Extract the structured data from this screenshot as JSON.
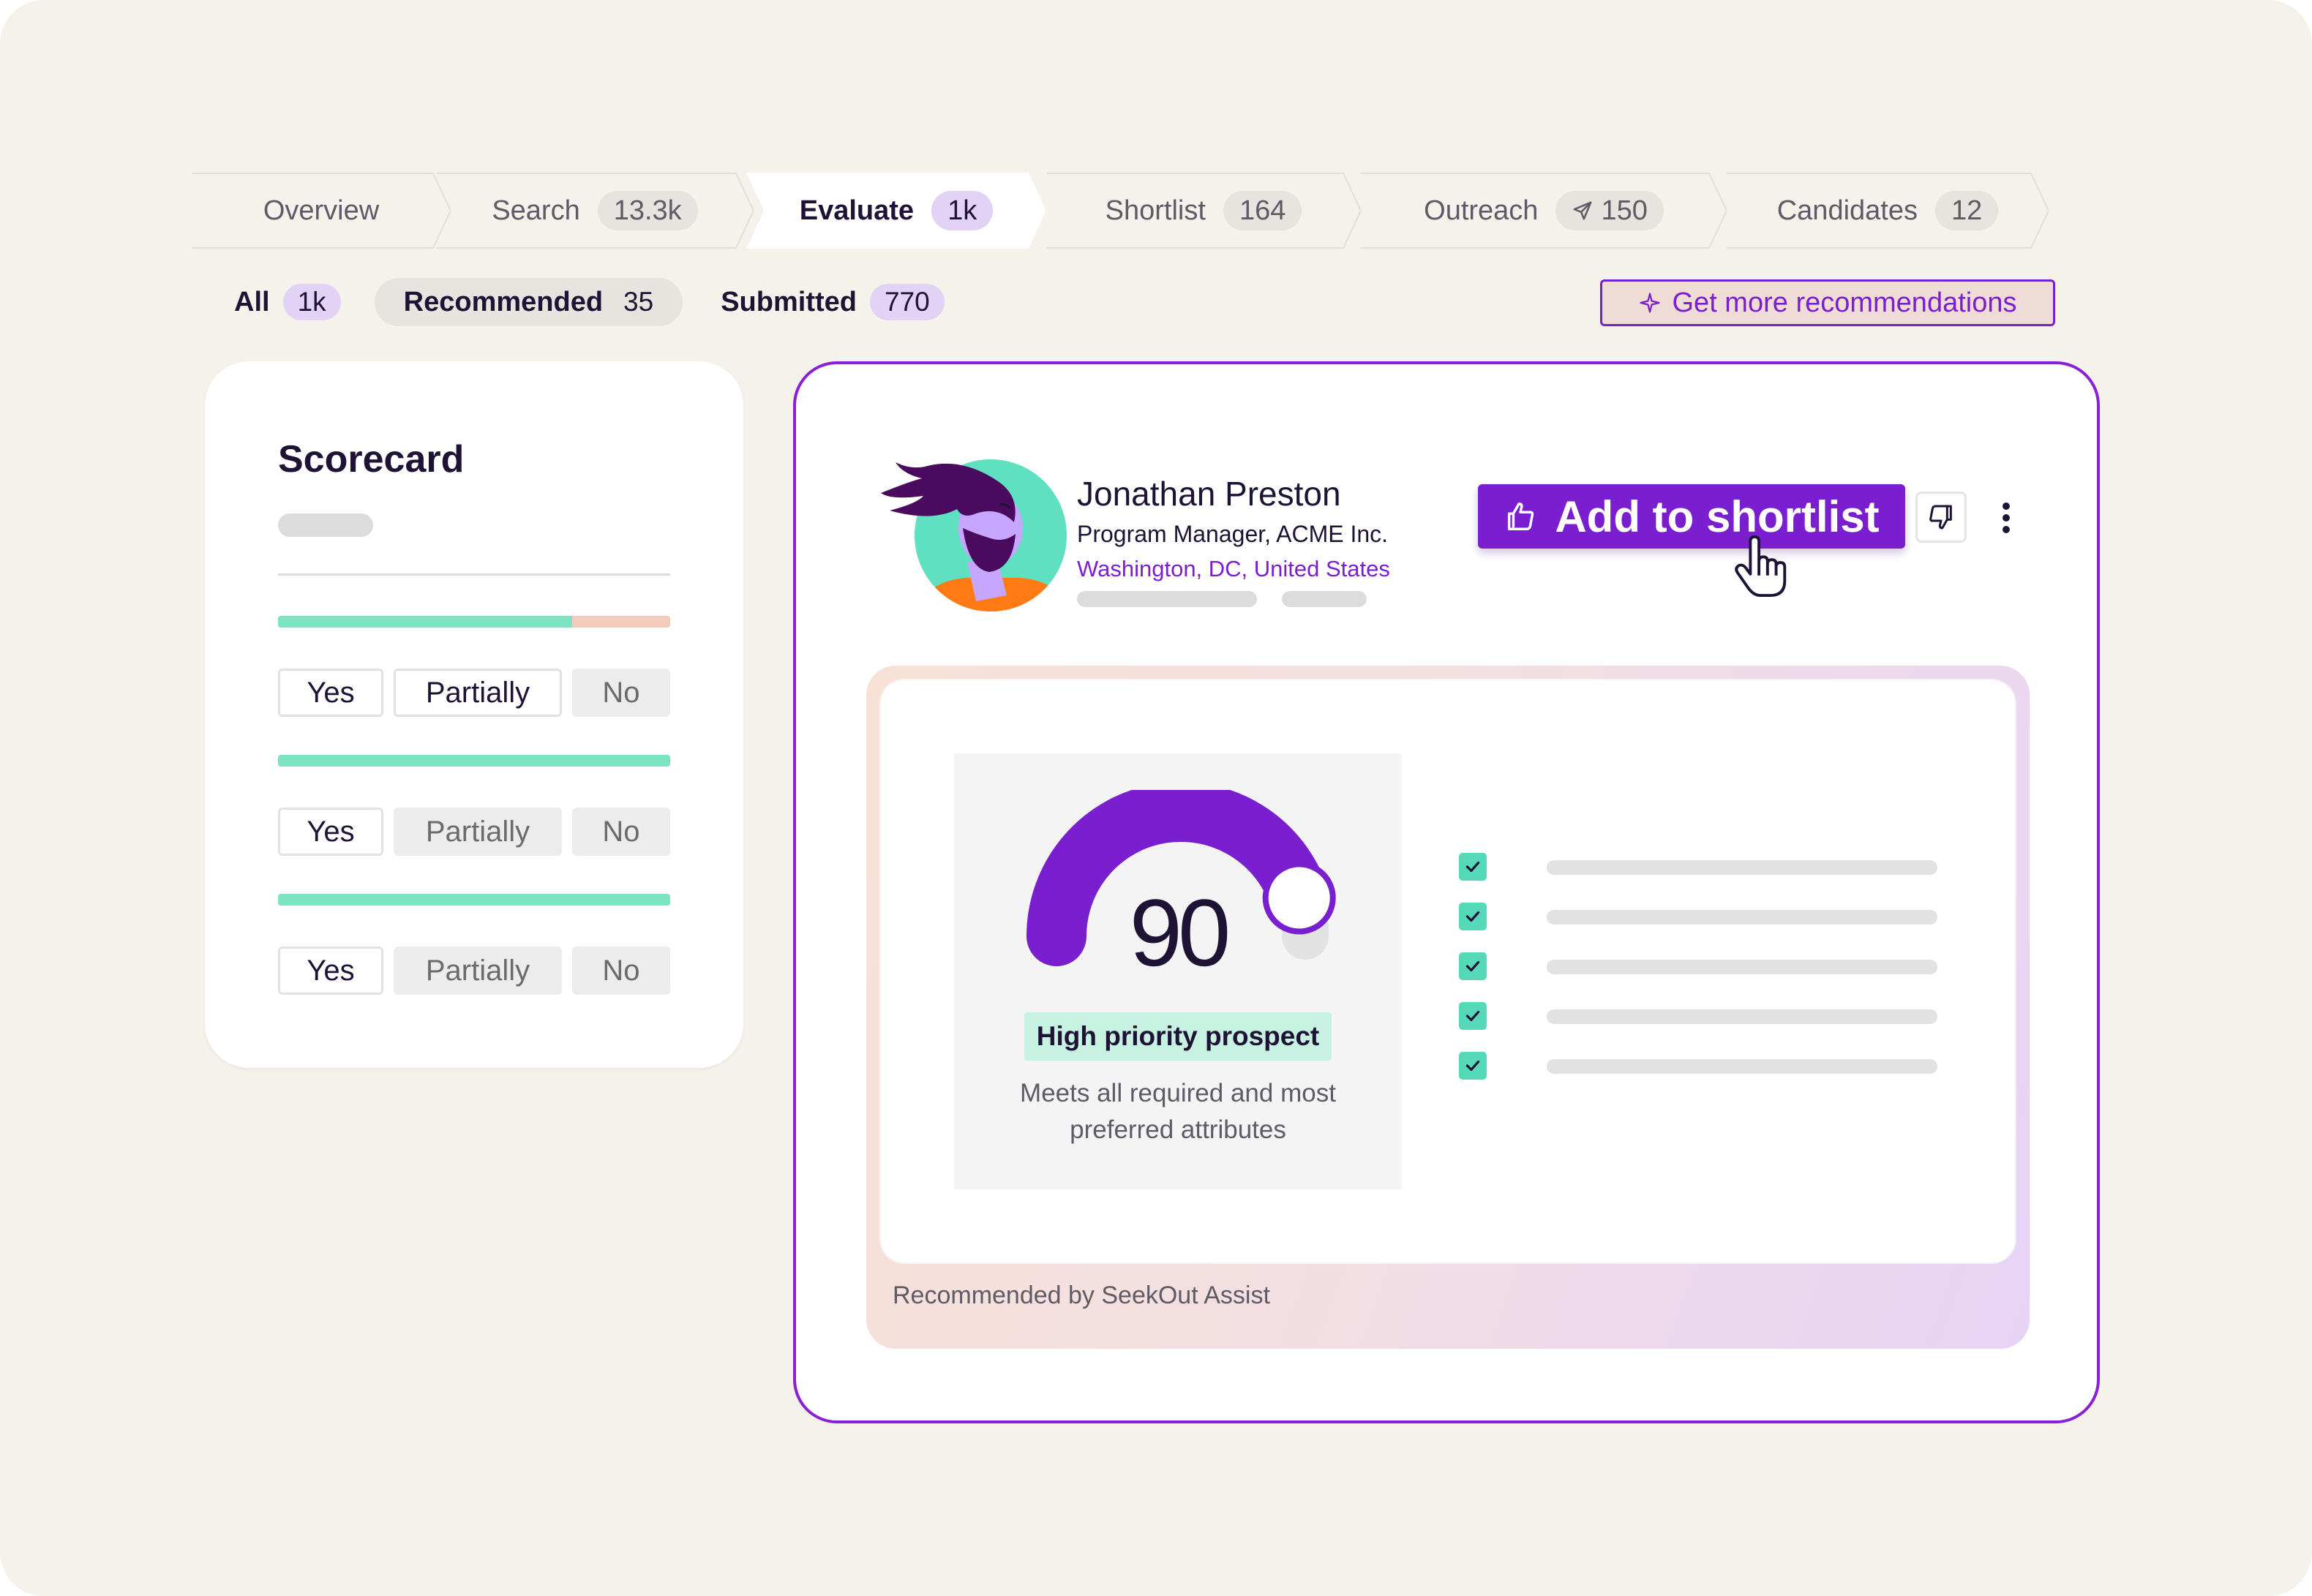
{
  "stages": [
    {
      "label": "Overview",
      "count": ""
    },
    {
      "label": "Search",
      "count": "13.3k"
    },
    {
      "label": "Evaluate",
      "count": "1k"
    },
    {
      "label": "Shortlist",
      "count": "164"
    },
    {
      "label": "Outreach",
      "count": "150",
      "count_icon": "send-icon"
    },
    {
      "label": "Candidates",
      "count": "12"
    }
  ],
  "active_stage": "Evaluate",
  "filters": [
    {
      "label": "All",
      "count": "1k"
    },
    {
      "label": "Recommended",
      "count": "35"
    },
    {
      "label": "Submitted",
      "count": "770"
    }
  ],
  "selected_filter": "Recommended",
  "get_more_label": "Get more recommendations",
  "scorecard": {
    "title": "Scorecard",
    "options": {
      "yes": "Yes",
      "partially": "Partially",
      "no": "No"
    },
    "criteria": [
      {
        "fill": 0.75,
        "selected": "Partially"
      },
      {
        "fill": 1.0,
        "selected": "Yes"
      },
      {
        "fill": 1.0,
        "selected": "Yes"
      }
    ]
  },
  "candidate": {
    "name": "Jonathan Preston",
    "title": "Program Manager, ACME Inc.",
    "location": "Washington, DC, United States"
  },
  "actions": {
    "shortlist_label": "Add to shortlist",
    "dislike_icon": "thumbs-down-icon",
    "more_icon": "more-vertical-icon"
  },
  "assist": {
    "score": "90",
    "score_fraction": 0.9,
    "priority": "High priority prospect",
    "description": "Meets all required and most preferred attributes",
    "footer": "Recommended by SeekOut Assist",
    "checklist_count": 5
  },
  "colors": {
    "accent": "#7a1fd0",
    "background": "#f5f1eb",
    "mint": "#7de3c2",
    "check": "#55d9b8"
  }
}
